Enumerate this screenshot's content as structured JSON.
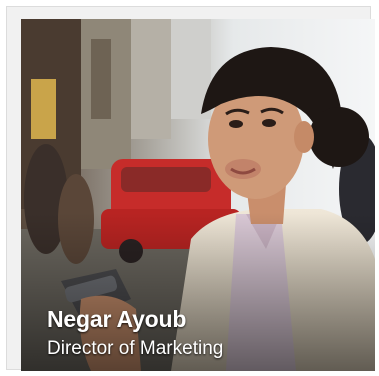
{
  "profile": {
    "name": "Negar Ayoub",
    "title": "Director of Marketing"
  }
}
